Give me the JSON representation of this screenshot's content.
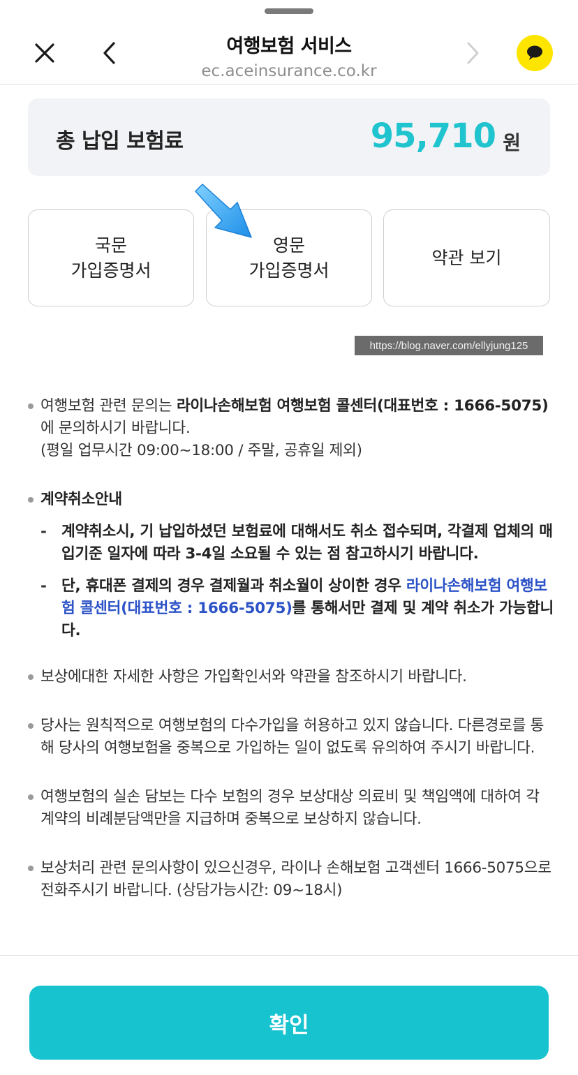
{
  "header": {
    "title": "여행보험 서비스",
    "url": "ec.aceinsurance.co.kr"
  },
  "premium": {
    "label": "총 납입 보험료",
    "amount": "95,710",
    "unit": "원"
  },
  "buttons": {
    "korean_cert_line1": "국문",
    "korean_cert_line2": "가입증명서",
    "english_cert_line1": "영문",
    "english_cert_line2": "가입증명서",
    "terms": "약관 보기"
  },
  "watermark": "https://blog.naver.com/ellyjung125",
  "notices": {
    "n1_a": "여행보험 관련 문의는 ",
    "n1_bold": "라이나손해보험 여행보험 콜센터(대표번호 : 1666-5075)",
    "n1_b": "에 문의하시기 바랍니다.",
    "n1_hours": "(평일 업무시간 09:00~18:00 / 주말, 공휴일 제외)",
    "cancel_title": "계약취소안내",
    "cancel_dash": "-",
    "cancel_1": "계약취소시, 기 납입하셨던 보험료에 대해서도 취소 접수되며, 각결제 업체의 매입기준 일자에 따라 3-4일 소요될 수 있는 점 참고하시기 바랍니다.",
    "cancel_2_a": "단, 휴대폰 결제의 경우 결제월과 취소월이 상이한 경우 ",
    "cancel_2_link": "라이나손해보험 여행보험 콜센터(대표번호 : 1666-5075)",
    "cancel_2_b": "를 통해서만 결제 및 계약 취소가 가능합니다.",
    "n3": "보상에대한 자세한 사항은 가입확인서와 약관을 참조하시기 바랍니다.",
    "n4": "당사는 원칙적으로 여행보험의 다수가입을 허용하고 있지 않습니다. 다른경로를 통해 당사의 여행보험을 중복으로 가입하는 일이 없도록 유의하여 주시기 바랍니다.",
    "n5": "여행보험의 실손 담보는 다수 보험의 경우 보상대상 의료비 및 책임액에 대하여 각 계약의 비례분담액만을 지급하며 중복으로 보상하지 않습니다.",
    "n6": "보상처리 관련 문의사항이 있으신경우, 라이나 손해보험 고객센터 1666-5075으로 전화주시기 바랍니다. (상담가능시간: 09~18시)"
  },
  "confirm_label": "확인",
  "colors": {
    "accent": "#18c3d0",
    "amount": "#1fc4cf",
    "link": "#2b52c7",
    "kakao_yellow": "#fee500"
  }
}
